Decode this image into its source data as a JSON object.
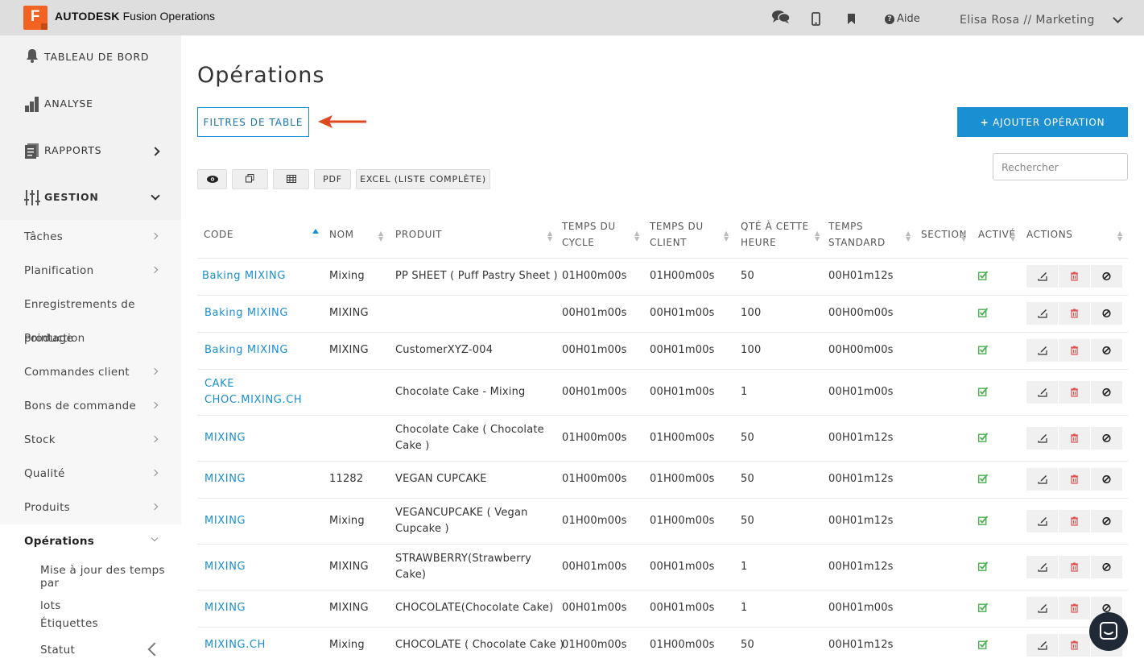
{
  "header": {
    "brand_bold": "AUTODESK",
    "brand_rest": "Fusion Operations",
    "logo_letter": "F",
    "help_label": "Aide",
    "user_label": "Elisa Rosa // Marketing"
  },
  "sidebar": {
    "main_items": [
      {
        "label": "TABLEAU DE BORD"
      },
      {
        "label": "ANALYSE"
      },
      {
        "label": "RAPPORTS"
      },
      {
        "label": "GESTION"
      }
    ],
    "sub_items": [
      {
        "label": "Tâches"
      },
      {
        "label": "Planification"
      },
      {
        "label": "Enregistrements de"
      },
      {
        "label": "production"
      },
      {
        "label": "Pointage"
      },
      {
        "label": "Commandes client"
      },
      {
        "label": "Bons de commande"
      },
      {
        "label": "Stock"
      },
      {
        "label": "Qualité"
      },
      {
        "label": "Produits"
      },
      {
        "label": "Opérations"
      }
    ],
    "subsub_items": [
      {
        "label": "Mise à jour des temps par"
      },
      {
        "label": "lots"
      },
      {
        "label": "Étiquettes"
      },
      {
        "label": "Statut"
      }
    ]
  },
  "main": {
    "title": "Opérations",
    "filter_button": "FILTRES DE TABLE",
    "add_button": "AJOUTER OPÉRATION",
    "add_plus": "+",
    "search_placeholder": "Rechercher",
    "toolbar": {
      "pdf": "PDF",
      "excel": "EXCEL (LISTE COMPLÈTE)"
    }
  },
  "table": {
    "headers": {
      "code": "CODE",
      "nom": "NOM",
      "produit": "PRODUIT",
      "cycle_1": "TEMPS DU",
      "cycle_2": "CYCLE",
      "client_1": "TEMPS DU",
      "client_2": "CLIENT",
      "qte_1": "QTÉ À CETTE",
      "qte_2": "HEURE",
      "std_1": "TEMPS",
      "std_2": "STANDARD",
      "section": "SECTION",
      "active": "ACTIVÉ",
      "actions": "ACTIONS"
    },
    "rows": [
      {
        "code": [
          "Baking MIXING"
        ],
        "nom": "Mixing",
        "produit": [
          "PP SHEET ( Puff Pastry Sheet )"
        ],
        "cycle": "01H00m00s",
        "client": "01H00m00s",
        "qte": "50",
        "std": "00H01m12s"
      },
      {
        "code": [
          "Baking MIXING"
        ],
        "nom": "MIXING",
        "produit": [
          ""
        ],
        "cycle": "00H01m00s",
        "client": "00H01m00s",
        "qte": "100",
        "std": "00H00m00s"
      },
      {
        "code": [
          "Baking MIXING"
        ],
        "nom": "MIXING",
        "produit": [
          "CustomerXYZ-004"
        ],
        "cycle": "00H01m00s",
        "client": "00H01m00s",
        "qte": "100",
        "std": "00H00m00s"
      },
      {
        "code": [
          "CAKE",
          "CHOC.MIXING.CH"
        ],
        "nom": "",
        "produit": [
          "Chocolate Cake - Mixing"
        ],
        "cycle": "00H01m00s",
        "client": "00H01m00s",
        "qte": "1",
        "std": "00H01m00s"
      },
      {
        "code": [
          "MIXING"
        ],
        "nom": "",
        "produit": [
          "Chocolate Cake ( Chocolate",
          "Cake )"
        ],
        "cycle": "01H00m00s",
        "client": "01H00m00s",
        "qte": "50",
        "std": "00H01m12s"
      },
      {
        "code": [
          "MIXING"
        ],
        "nom": "11282",
        "produit": [
          "VEGAN CUPCAKE"
        ],
        "cycle": "01H00m00s",
        "client": "01H00m00s",
        "qte": "50",
        "std": "00H01m12s"
      },
      {
        "code": [
          "MIXING"
        ],
        "nom": "Mixing",
        "produit": [
          "VEGANCUPCAKE ( Vegan",
          "Cupcake )"
        ],
        "cycle": "01H00m00s",
        "client": "01H00m00s",
        "qte": "50",
        "std": "00H01m12s"
      },
      {
        "code": [
          "MIXING"
        ],
        "nom": "MIXING",
        "produit": [
          "STRAWBERRY(Strawberry",
          "Cake)"
        ],
        "cycle": "00H01m00s",
        "client": "00H01m00s",
        "qte": "1",
        "std": "00H01m12s"
      },
      {
        "code": [
          "MIXING"
        ],
        "nom": "MIXING",
        "produit": [
          "CHOCOLATE(Chocolate Cake)"
        ],
        "cycle": "00H01m00s",
        "client": "00H01m00s",
        "qte": "1",
        "std": "00H01m00s"
      },
      {
        "code": [
          "MIXING.CH"
        ],
        "nom": "Mixing",
        "produit": [
          "CHOCOLATE ( Chocolate Cake )"
        ],
        "cycle": "01H00m00s",
        "client": "01H00m00s",
        "qte": "50",
        "std": "00H01m12s"
      }
    ]
  },
  "colors": {
    "accent": "#1a8fd1",
    "logo": "#f26322",
    "check": "#4caf50",
    "delete": "#e05050",
    "arrow": "#e0481f"
  }
}
